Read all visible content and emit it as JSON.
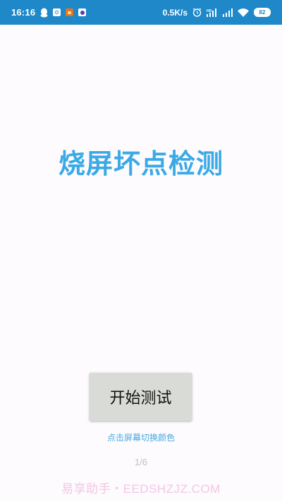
{
  "status_bar": {
    "time": "16:16",
    "net_speed": "0.5K/s",
    "battery_level": "82",
    "icons": [
      "qq-icon",
      "app-icon-blue",
      "app-icon-orange",
      "app-icon-purple",
      "alarm-icon",
      "hd-signal-icon",
      "signal-icon",
      "wifi-icon",
      "battery-icon"
    ],
    "color": "#1e88c9"
  },
  "main": {
    "title": "烧屏坏点检测",
    "title_color": "#3aa9e6",
    "start_button_label": "开始测试",
    "hint": "点击屏幕切换颜色",
    "page_indicator": "1/6"
  },
  "watermark": {
    "text": "易享助手・EEDSHZJZ.COM"
  }
}
